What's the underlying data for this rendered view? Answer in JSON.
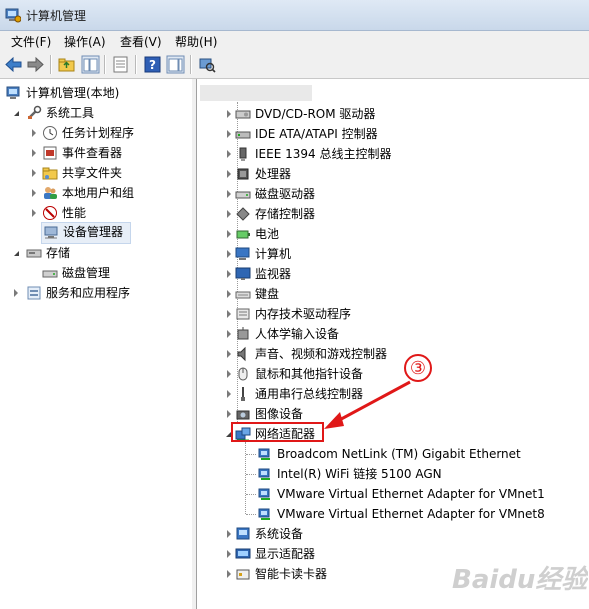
{
  "window": {
    "title": "计算机管理"
  },
  "menu": [
    "文件(F)",
    "操作(A)",
    "查看(V)",
    "帮助(H)"
  ],
  "left_tree": [
    {
      "label": "计算机管理(本地)"
    },
    {
      "label": "系统工具"
    },
    {
      "label": "任务计划程序"
    },
    {
      "label": "事件查看器"
    },
    {
      "label": "共享文件夹"
    },
    {
      "label": "本地用户和组"
    },
    {
      "label": "性能"
    },
    {
      "label": "设备管理器"
    },
    {
      "label": "存储"
    },
    {
      "label": "磁盘管理"
    },
    {
      "label": "服务和应用程序"
    }
  ],
  "devices": [
    "DVD/CD-ROM 驱动器",
    "IDE ATA/ATAPI 控制器",
    "IEEE 1394 总线主控制器",
    "处理器",
    "磁盘驱动器",
    "存储控制器",
    "电池",
    "计算机",
    "监视器",
    "键盘",
    "内存技术驱动程序",
    "人体学输入设备",
    "声音、视频和游戏控制器",
    "鼠标和其他指针设备",
    "通用串行总线控制器",
    "图像设备",
    "网络适配器",
    "Broadcom NetLink (TM) Gigabit Ethernet",
    "Intel(R) WiFi 链接 5100 AGN",
    "VMware Virtual Ethernet Adapter for VMnet1",
    "VMware Virtual Ethernet Adapter for VMnet8",
    "系统设备",
    "显示适配器",
    "智能卡读卡器"
  ],
  "annotation": {
    "number": "③"
  },
  "watermark": {
    "text": "Baidu经验"
  },
  "colors": {
    "highlight": "#e01818",
    "title_bg": "#dfe9f5",
    "selection": "#e7eef7"
  }
}
